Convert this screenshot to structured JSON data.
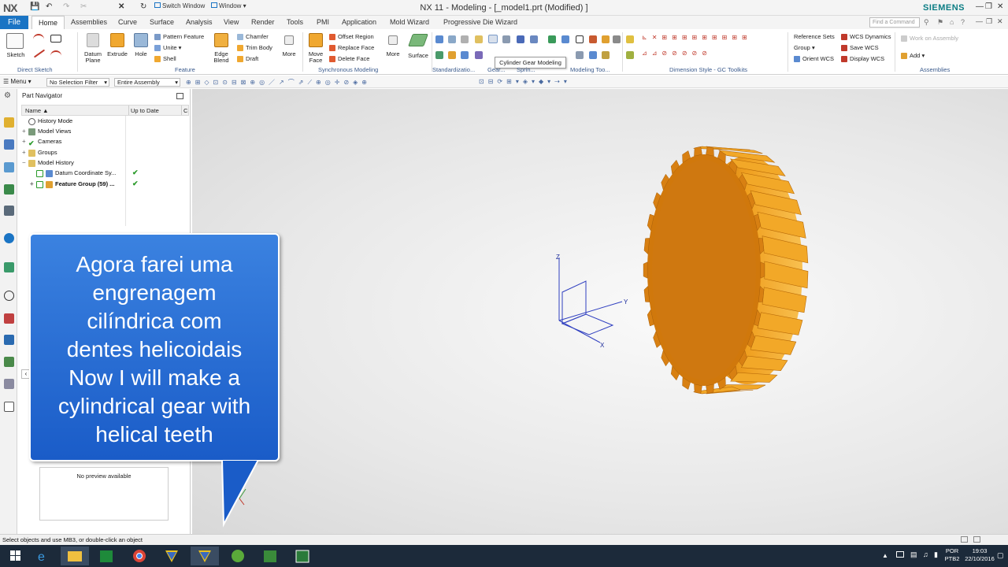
{
  "titlebar": {
    "logo": "NX",
    "switch_window": "Switch Window",
    "window_menu": "Window",
    "title": "NX 11 - Modeling - [_model1.prt (Modified) ]",
    "brand": "SIEMENS"
  },
  "tabs": {
    "file": "File",
    "items": [
      "Home",
      "Assemblies",
      "Curve",
      "Surface",
      "Analysis",
      "View",
      "Render",
      "Tools",
      "PMI",
      "Application",
      "Mold Wizard",
      "Progressive Die Wizard"
    ],
    "search_placeholder": "Find a Command"
  },
  "ribbon": {
    "sketch": "Sketch",
    "direct_sketch": "Direct Sketch",
    "datum_plane": "Datum Plane",
    "extrude": "Extrude",
    "hole": "Hole",
    "pattern_feature": "Pattern Feature",
    "unite": "Unite",
    "shell": "Shell",
    "edge_blend": "Edge Blend",
    "chamfer": "Chamfer",
    "trim_body": "Trim Body",
    "draft": "Draft",
    "more": "More",
    "feature": "Feature",
    "move_face": "Move Face",
    "offset_region": "Offset Region",
    "replace_face": "Replace Face",
    "delete_face": "Delete Face",
    "more2": "More",
    "synchronous_modeling": "Synchronous Modeling",
    "surface": "Surface",
    "standardization": "Standardizatio...",
    "gear_label": "Gear...",
    "spring_label": "Sprin...",
    "modeling_tool": "Modeling Too...",
    "tooltip": "Cylinder Gear Modeling",
    "dimension_style": "Dimension Style - GC Toolkits",
    "reference_sets": "Reference Sets",
    "group": "Group",
    "orient_wcs": "Orient WCS",
    "wcs_dynamics": "WCS Dynamics",
    "save_wcs": "Save WCS",
    "display_wcs": "Display WCS",
    "work_on_assembly": "Work on Assembly",
    "add": "Add",
    "assemblies": "Assemblies"
  },
  "selbar": {
    "menu": "Menu",
    "filter": "No Selection Filter",
    "scope": "Entire Assembly"
  },
  "navigator": {
    "title": "Part Navigator",
    "col_name": "Name",
    "col_uptodate": "Up to Date",
    "col_c": "C",
    "rows": [
      {
        "label": "History Mode",
        "check": ""
      },
      {
        "label": "Model Views",
        "check": ""
      },
      {
        "label": "Cameras",
        "check": ""
      },
      {
        "label": "Groups",
        "check": ""
      },
      {
        "label": "Model History",
        "check": ""
      },
      {
        "label": "Datum Coordinate Sy...",
        "check": "✔"
      },
      {
        "label": "Feature Group (59) ...",
        "check": "✔"
      }
    ],
    "preview": "No preview available"
  },
  "callout": {
    "lines": [
      "Agora farei uma",
      "engrenagem",
      "cilíndrica com",
      "dentes helicoidais",
      "Now I will make a",
      "cylindrical gear with",
      "helical teeth"
    ]
  },
  "axes": {
    "x": "X",
    "y": "Y",
    "z": "Z"
  },
  "status": "Select objects and use MB3, or double-click an object",
  "taskbar": {
    "lang1": "POR",
    "lang2": "PTB2",
    "time": "19:03",
    "date": "22/10/2016"
  },
  "colors": {
    "accent": "#1a74c4",
    "callout": "#2a6fd8",
    "gear": "#e8960f",
    "brand": "#0b7d84"
  }
}
